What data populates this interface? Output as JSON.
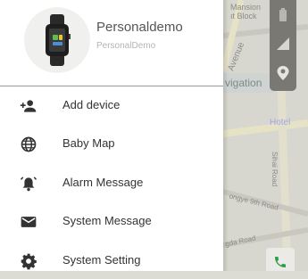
{
  "profile": {
    "name": "Personaldemo",
    "subtitle": "PersonalDemo"
  },
  "menu": {
    "items": [
      {
        "label": "Add device",
        "icon": "add-person-icon"
      },
      {
        "label": "Baby Map",
        "icon": "globe-icon"
      },
      {
        "label": "Alarm Message",
        "icon": "alarm-bell-icon"
      },
      {
        "label": "System Message",
        "icon": "mail-icon"
      },
      {
        "label": "System Setting",
        "icon": "gear-icon"
      }
    ]
  },
  "map": {
    "labels": {
      "mansion": "Mansion",
      "block": "ıt Block",
      "avenue": "Avenue",
      "navigation": "vigation",
      "hotel": "Hotel",
      "sihai_road": "Sihai Road",
      "songye_road": "ongye 9th Road",
      "gda_road": "gda Road"
    },
    "tools": [
      "battery-icon",
      "signal-icon",
      "location-pin-icon"
    ],
    "call_button_icon": "phone-icon"
  },
  "colors": {
    "drawer_bg": "#ffffff",
    "map_toolbar": "#7a7873",
    "call_icon": "#2e9e4a",
    "text_primary": "#333333",
    "text_secondary": "#b4b4b4"
  }
}
